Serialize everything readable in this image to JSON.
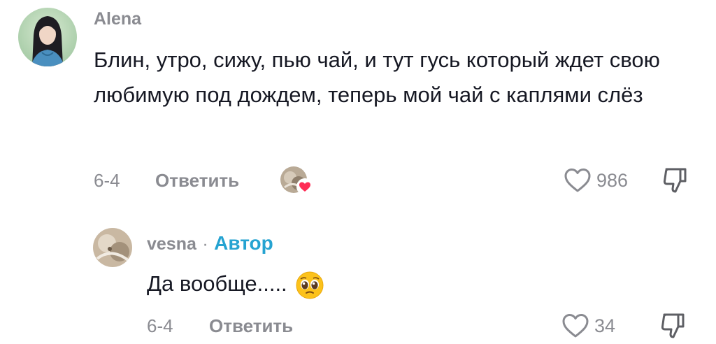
{
  "comments": [
    {
      "username": "Alena",
      "text": "Блин, утро, сижу, пью чай, и тут гусь который ждет свою любимую под дождем, теперь мой чай с каплями слёз",
      "date": "6-4",
      "reply_label": "Ответить",
      "likes": "986",
      "liked_by_creator": true
    },
    {
      "username": "vesna",
      "separator": "·",
      "author_label": "Автор",
      "text": "Да вообще.....",
      "emoji": "pleading-face-icon",
      "date": "6-4",
      "reply_label": "Ответить",
      "likes": "34"
    }
  ],
  "colors": {
    "text": "#161823",
    "muted": "#8a8b91",
    "author": "#25a3d1",
    "heart_badge": "#fe2c55"
  }
}
